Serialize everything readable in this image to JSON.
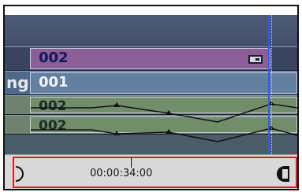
{
  "tracks": {
    "video_upper": {
      "label": "002"
    },
    "video_lower": {
      "row_label": "ng",
      "label": "001"
    },
    "audio_1": {
      "label": "002"
    },
    "audio_2": {
      "label": "002"
    }
  },
  "timebar": {
    "timecode": "00:00:34:00"
  },
  "colors": {
    "playhead": "#2a5bff",
    "clip_purple": "#8b5f95",
    "clip_blue": "#6480a0",
    "clip_green": "#728d6a",
    "in_out_frame": "#e21a1a"
  },
  "icons": {
    "clip_marker": "clip-marker-icon",
    "in_point": "in-point-bracket-icon",
    "out_point": "out-point-bracket-icon"
  }
}
